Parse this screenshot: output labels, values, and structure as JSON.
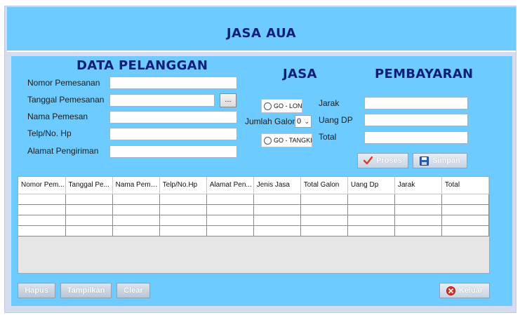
{
  "app": {
    "title": "JASA AUA"
  },
  "data_pelanggan": {
    "title": "DATA PELANGGAN",
    "fields": [
      {
        "label": "Nomor Pemesanan",
        "value": ""
      },
      {
        "label": "Tanggal Pemesanan",
        "value": "",
        "button": "..."
      },
      {
        "label": "Nama Pemesan",
        "value": ""
      },
      {
        "label": "Telp/No. Hp",
        "value": ""
      },
      {
        "label": "Alamat Pengiriman",
        "value": ""
      }
    ]
  },
  "jasa": {
    "title": "JASA",
    "option1": "GO - LON",
    "jumlah_label": "Jumlah Galon",
    "jumlah_value": "0",
    "option2": "GO - TANGKI"
  },
  "pembayaran": {
    "title": "PEMBAYARAN",
    "fields": [
      {
        "label": "Jarak",
        "value": ""
      },
      {
        "label": "Uang DP",
        "value": ""
      },
      {
        "label": "Total",
        "value": ""
      }
    ],
    "proses_label": "Proses",
    "simpan_label": "Simpan"
  },
  "table": {
    "columns": [
      "Nomor Pem...",
      "Tanggal Pe...",
      "Nama Peme...",
      "Telp/No.Hp",
      "Alamat Pen...",
      "Jenis Jasa",
      "Total Galon",
      "Uang Dp",
      "Jarak",
      "Total"
    ],
    "rows": [
      [
        "",
        "",
        "",
        "",
        "",
        "",
        "",
        "",
        "",
        ""
      ],
      [
        "",
        "",
        "",
        "",
        "",
        "",
        "",
        "",
        "",
        ""
      ],
      [
        "",
        "",
        "",
        "",
        "",
        "",
        "",
        "",
        "",
        ""
      ],
      [
        "",
        "",
        "",
        "",
        "",
        "",
        "",
        "",
        "",
        ""
      ]
    ]
  },
  "footer": {
    "hapus_label": "Hapus",
    "tampilkan_label": "Tampilkan",
    "clear_label": "Clear",
    "keluar_label": "Keluar"
  },
  "icons": {
    "proses": "checkmark-icon",
    "simpan": "floppy-disk-icon",
    "keluar": "close-circle-icon"
  },
  "colors": {
    "panel": "#6ecbff",
    "title": "#0b1f7a",
    "checkmark": "#e03a1e",
    "keluar": "#d8332a"
  }
}
